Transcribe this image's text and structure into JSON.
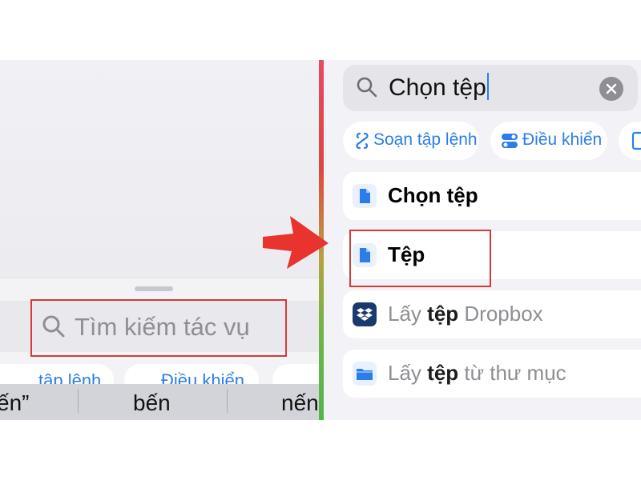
{
  "left": {
    "search_placeholder": "Tìm kiếm tác vụ",
    "chip_peeks": [
      "tập lệnh",
      "Điều khiển"
    ],
    "keyboard_suggestions": [
      "ến”",
      "bến",
      "nến"
    ]
  },
  "right": {
    "search_value": "Chọn tệp",
    "chips": [
      {
        "label": "Soạn tập lệnh",
        "icon": "script-icon"
      },
      {
        "label": "Điều khiển",
        "icon": "toggle-icon"
      },
      {
        "label": "",
        "icon": "phone-icon"
      }
    ],
    "results": [
      {
        "bold": "Chọn tệp",
        "suffix": "",
        "prefix": "",
        "icon": "document-icon",
        "style": "dark"
      },
      {
        "bold": "Tệp",
        "suffix": "",
        "prefix": "",
        "icon": "document-icon",
        "style": "dark"
      },
      {
        "prefix": "Lấy ",
        "bold": "tệp",
        "suffix": " Dropbox",
        "icon": "dropbox-icon",
        "style": "gray"
      },
      {
        "prefix": "Lấy ",
        "bold": "tệp",
        "suffix": " từ thư mục",
        "icon": "folder-icon",
        "style": "gray"
      }
    ]
  },
  "colors": {
    "accent": "#2b7de9",
    "highlight": "#d43a3a",
    "arrow": "#e8332f",
    "dropbox": "#1a3a6e"
  }
}
